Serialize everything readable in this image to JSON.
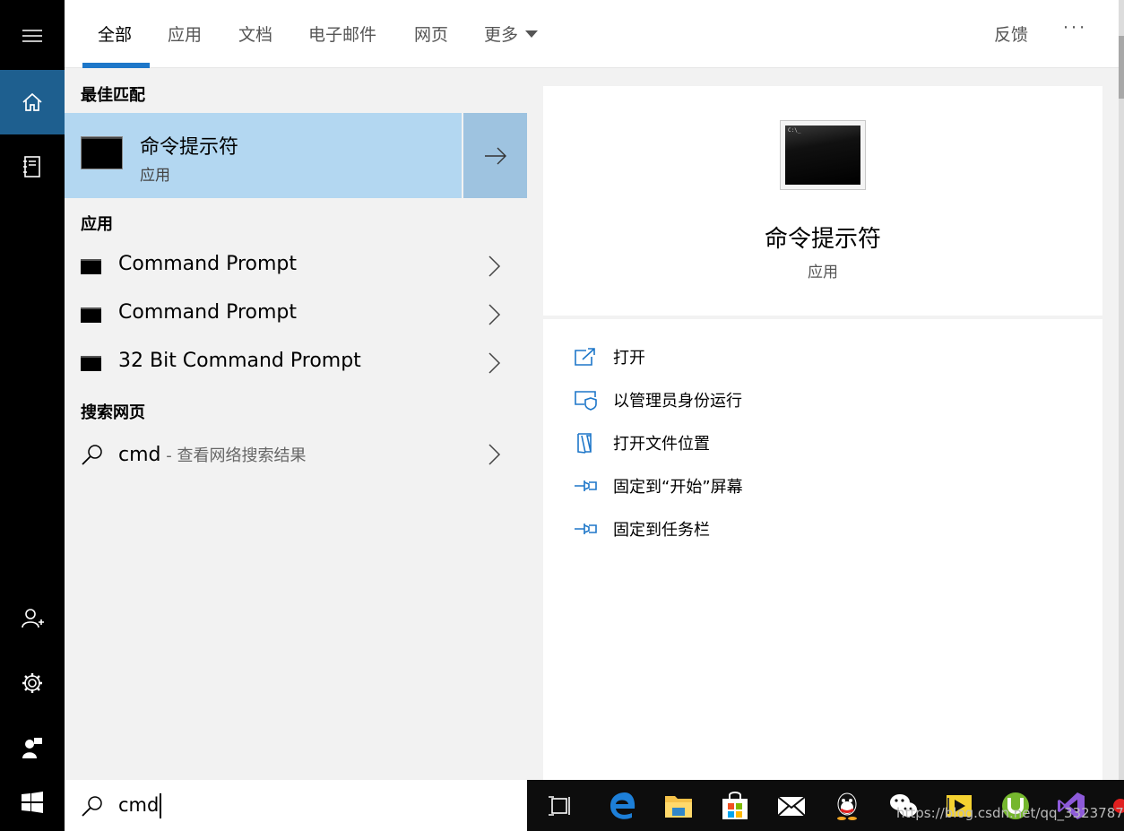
{
  "tabs": {
    "all": "全部",
    "apps": "应用",
    "documents": "文档",
    "email": "电子邮件",
    "web": "网页",
    "more": "更多",
    "feedback": "反馈",
    "overflow": "···"
  },
  "results": {
    "best_match_header": "最佳匹配",
    "best_match": {
      "title": "命令提示符",
      "subtitle": "应用"
    },
    "apps_header": "应用",
    "apps": [
      {
        "label": "Command Prompt"
      },
      {
        "label": "Command Prompt"
      },
      {
        "label": "32 Bit Command Prompt"
      }
    ],
    "web_header": "搜索网页",
    "web_result": {
      "query": "cmd",
      "hint": " - 查看网络搜索结果"
    }
  },
  "detail": {
    "title": "命令提示符",
    "subtitle": "应用",
    "icon_prompt": "C:\\_",
    "actions": [
      {
        "label": "打开",
        "icon": "open-icon"
      },
      {
        "label": "以管理员身份运行",
        "icon": "shield-icon"
      },
      {
        "label": "打开文件位置",
        "icon": "file-location-icon"
      },
      {
        "label": "固定到“开始”屏幕",
        "icon": "pin-icon"
      },
      {
        "label": "固定到任务栏",
        "icon": "pin-icon"
      }
    ]
  },
  "search": {
    "value": "cmd"
  },
  "sidebar": {
    "items": [
      "hamburger-menu-icon",
      "home-icon",
      "notebook-icon",
      "account-add-icon",
      "settings-icon",
      "feedback-person-icon",
      "windows-start-icon"
    ]
  },
  "taskbar": {
    "icons": [
      "task-view-icon",
      "edge-icon",
      "file-explorer-icon",
      "store-icon",
      "mail-icon",
      "qq-icon",
      "wechat-icon",
      "labview-icon",
      "utorrent-icon",
      "visual-studio-icon"
    ]
  },
  "watermark": "https://blog.csdn.net/qq_33237871",
  "colors": {
    "accent": "#1e77c9",
    "rail_active": "#1e5f8f",
    "best_match_bg": "#b3d7f1",
    "best_match_arrow_bg": "#9ec3e0",
    "pane_bg": "#f2f2f2"
  }
}
